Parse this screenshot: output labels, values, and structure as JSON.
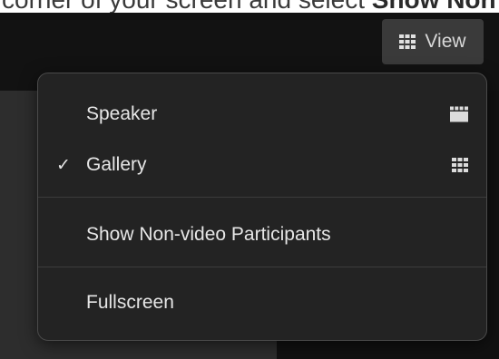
{
  "caption": {
    "prefix": "corner of your screen and select ",
    "bold": "Show Non"
  },
  "view_button": {
    "label": "View",
    "icon": "grid-icon"
  },
  "menu": {
    "items": [
      {
        "label": "Speaker",
        "checked": false,
        "icon": "speaker-layout-icon"
      },
      {
        "label": "Gallery",
        "checked": true,
        "check_glyph": "✓",
        "icon": "gallery-grid-icon"
      },
      {
        "label": "Show Non-video Participants",
        "checked": false
      },
      {
        "label": "Fullscreen",
        "checked": false
      }
    ]
  },
  "colors": {
    "menu_bg": "#232323",
    "button_bg": "#3a3a3a",
    "text": "#e6e6e6"
  }
}
